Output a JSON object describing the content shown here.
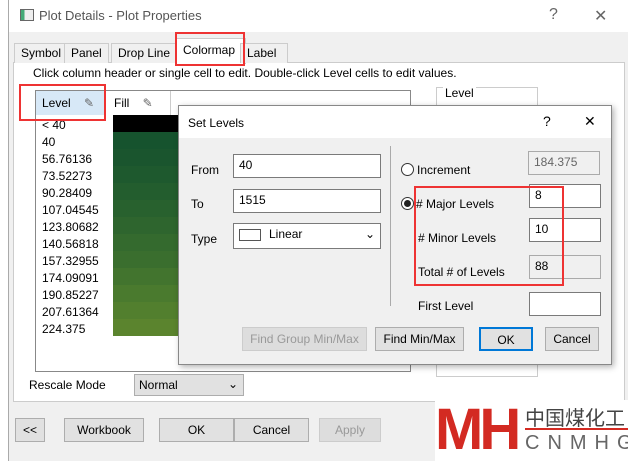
{
  "window": {
    "title": "Plot Details - Plot Properties",
    "help": "?",
    "close": "✕"
  },
  "tabs": [
    "Symbol",
    "Panel",
    "Drop Line",
    "Colormap",
    "Label"
  ],
  "hint": "Click column header or single cell to edit. Double-click Level cells to edit values.",
  "grid": {
    "level_header": "Level",
    "fill_header": "Fill",
    "levels": [
      "< 40",
      "40",
      "56.76136",
      "73.52273",
      "90.28409",
      "107.04545",
      "123.80682",
      "140.56818",
      "157.32955",
      "174.09091",
      "190.85227",
      "207.61364",
      "224.375"
    ],
    "fills": [
      "#000000",
      "#16532e",
      "#1a552e",
      "#1e592e",
      "#235d2e",
      "#28612e",
      "#2e652e",
      "#346a2e",
      "#3a6e2e",
      "#42742e",
      "#4a7a2e",
      "#527f2e",
      "#5b842e"
    ]
  },
  "level_group": "Level",
  "rescale": {
    "label": "Rescale Mode",
    "value": "Normal"
  },
  "bottom": {
    "prev": "<<",
    "workbook": "Workbook",
    "ok": "OK",
    "cancel": "Cancel",
    "apply": "Apply"
  },
  "set_levels": {
    "title": "Set Levels",
    "help": "?",
    "close": "✕",
    "from_label": "From",
    "from": "40",
    "to_label": "To",
    "to": "1515",
    "type_label": "Type",
    "type": "Linear",
    "increment_label": "Increment",
    "increment": "184.375",
    "major_label": "# Major Levels",
    "major": "8",
    "minor_label": "# Minor Levels",
    "minor": "10",
    "total_label": "Total # of Levels",
    "total": "88",
    "first_label": "First Level",
    "first": "",
    "find_group": "Find Group Min/Max",
    "find": "Find Min/Max",
    "ok": "OK",
    "cancel": "Cancel"
  },
  "watermark": {
    "logo": "MH",
    "cn": "中国煤化工",
    "en": "CNMHG"
  }
}
